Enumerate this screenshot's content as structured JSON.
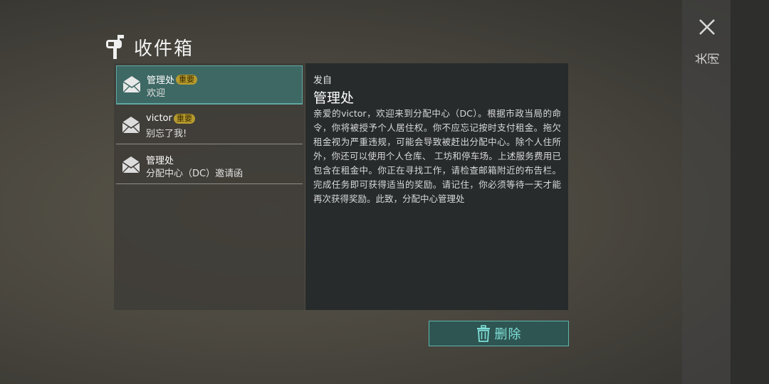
{
  "window": {
    "title": "收件箱"
  },
  "close": {
    "label": "关闭"
  },
  "mails": [
    {
      "sender": "管理处",
      "badge": "重要",
      "subject": "欢迎",
      "selected": true
    },
    {
      "sender": "victor",
      "badge": "重要",
      "subject": "别忘了我!",
      "selected": false
    },
    {
      "sender": "管理处",
      "badge": "",
      "subject": "分配中心（DC）邀请函",
      "selected": false
    }
  ],
  "detail": {
    "from_label": "发自",
    "from_name": "管理处",
    "body": "亲爱的victor，欢迎来到分配中心（DC）。根据市政当局的命令，你将被授予个人居住权。你不应忘记按时支付租金。拖欠租金视为严重违规，可能会导致被赶出分配中心。除个人住所外，你还可以使用个人仓库、 工坊和停车场。上述服务费用已包含在租金中。你正在寻找工作，请检查邮箱附近的布告栏。完成任务即可获得适当的奖励。请记住，你必须等待一天才能再次获得奖励。此致，分配中心管理处"
  },
  "actions": {
    "delete_label": "删除"
  },
  "colors": {
    "accent": "#5fb5ae",
    "selected_bg": "#3e6864",
    "badge": "#b59a2e"
  },
  "icons": {
    "title": "mailbox-icon",
    "mail": "envelope-icon",
    "delete": "trash-icon",
    "close": "close-icon"
  }
}
